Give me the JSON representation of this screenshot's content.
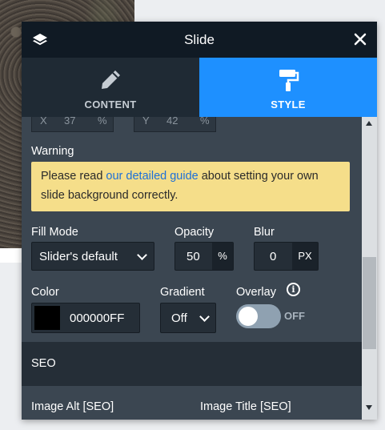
{
  "panel": {
    "title": "Slide",
    "tabs": [
      {
        "label": "CONTENT",
        "icon": "pencil-icon",
        "active": false
      },
      {
        "label": "STYLE",
        "icon": "paint-roller-icon",
        "active": true
      }
    ]
  },
  "position": {
    "x_label": "X",
    "x_value": "37",
    "x_unit": "%",
    "y_label": "Y",
    "y_value": "42",
    "y_unit": "%"
  },
  "warning": {
    "label": "Warning",
    "text_before": "Please read ",
    "link_text": "our detailed guide",
    "text_after": " about setting your own slide background correctly."
  },
  "fill_mode": {
    "label": "Fill Mode",
    "value": "Slider's default"
  },
  "opacity": {
    "label": "Opacity",
    "value": "50",
    "unit": "%"
  },
  "blur": {
    "label": "Blur",
    "value": "0",
    "unit": "PX"
  },
  "color": {
    "label": "Color",
    "value": "000000FF",
    "swatch": "#000000"
  },
  "gradient": {
    "label": "Gradient",
    "value": "Off"
  },
  "overlay": {
    "label": "Overlay",
    "state": "OFF"
  },
  "seo": {
    "section_label": "SEO",
    "image_alt_label": "Image Alt [SEO]",
    "image_title_label": "Image Title [SEO]"
  },
  "colors": {
    "accent": "#1e90ff",
    "panel": "#3b4651",
    "header": "#101a24",
    "warning_bg": "#f5de8a"
  }
}
